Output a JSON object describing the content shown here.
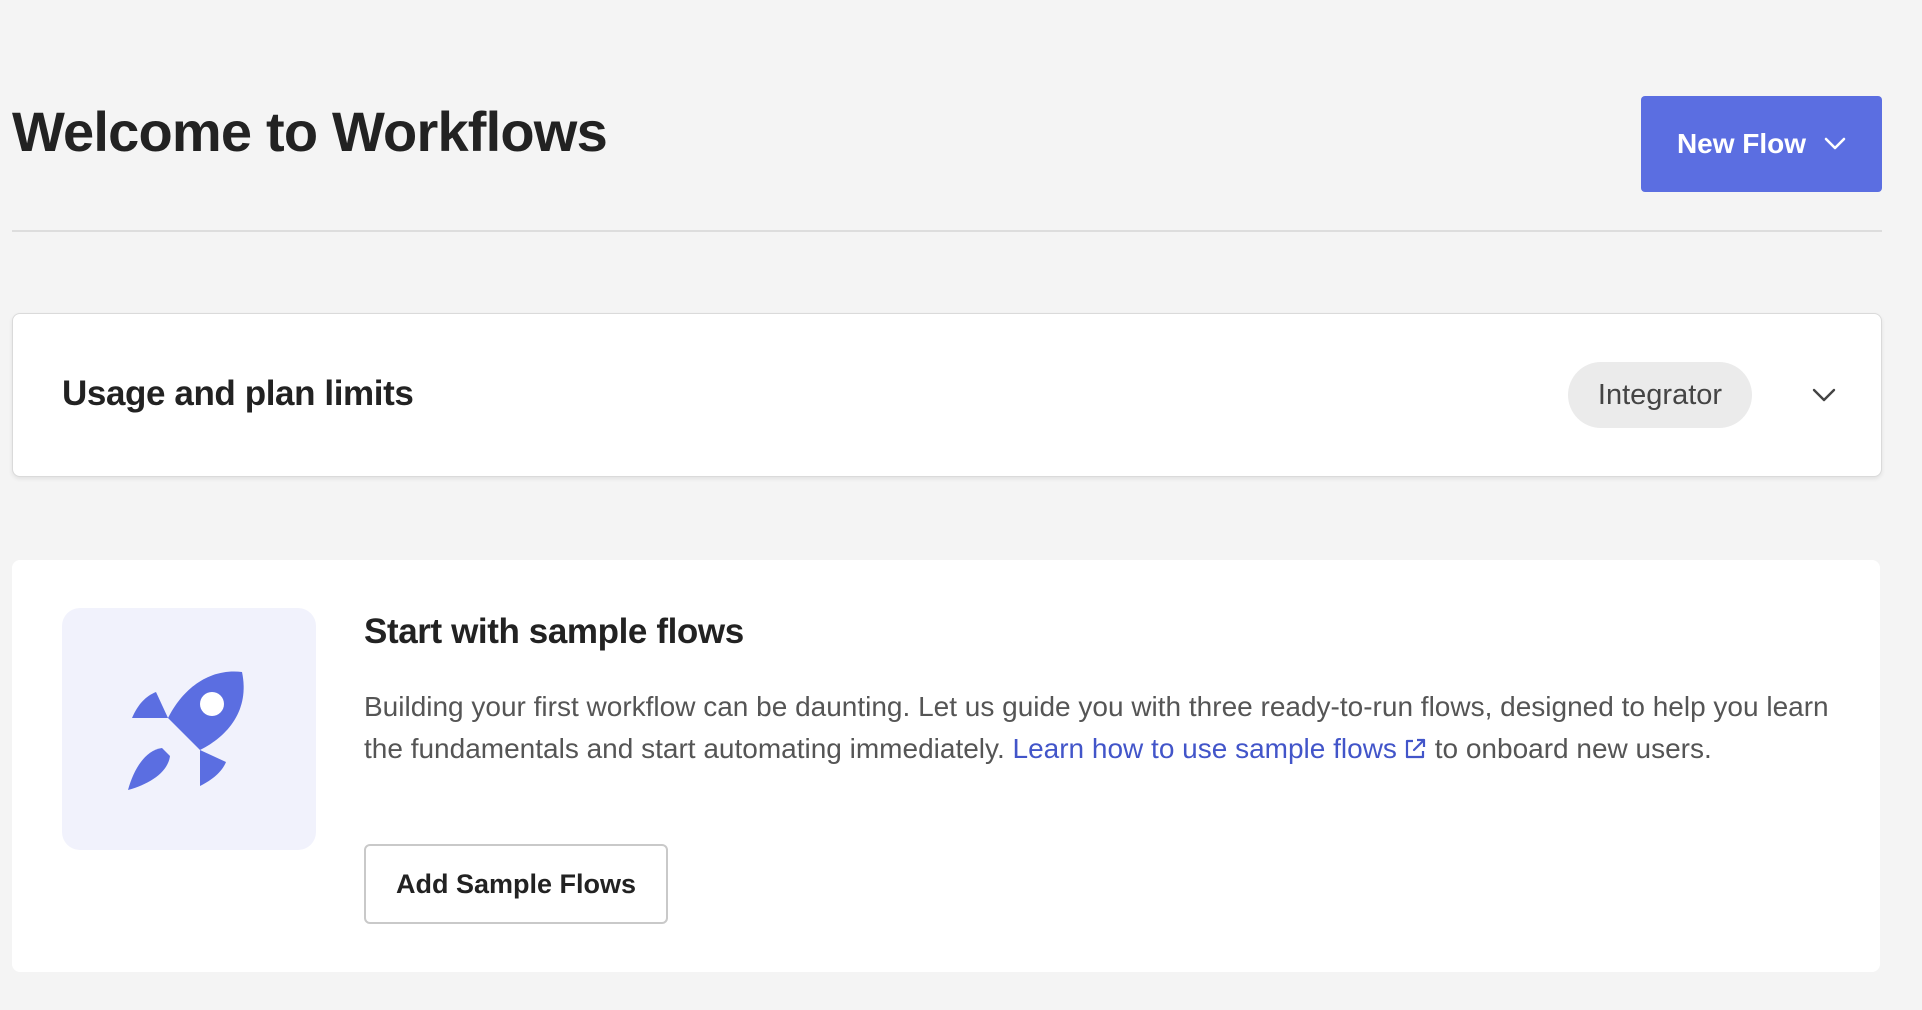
{
  "header": {
    "title": "Welcome to Workflows",
    "new_flow_label": "New Flow"
  },
  "usage": {
    "title": "Usage and plan limits",
    "plan_badge": "Integrator"
  },
  "sample_flows": {
    "title": "Start with sample flows",
    "description_before": "Building your first workflow can be daunting. Let us guide you with three ready-to-run flows, designed to help you learn the fundamentals and start automating immediately. ",
    "link_label": "Learn how to use sample flows",
    "description_after": " to onboard new users.",
    "button_label": "Add Sample Flows"
  },
  "icons": {
    "new_flow": "chevron-down-icon",
    "usage_toggle": "chevron-down-icon",
    "sample_tile": "rocket-icon",
    "link": "external-link-icon"
  },
  "colors": {
    "accent": "#5b6ee1",
    "link": "#4255c9",
    "page_background": "#f4f4f4",
    "icon_tile_background": "#f1f2fc"
  }
}
